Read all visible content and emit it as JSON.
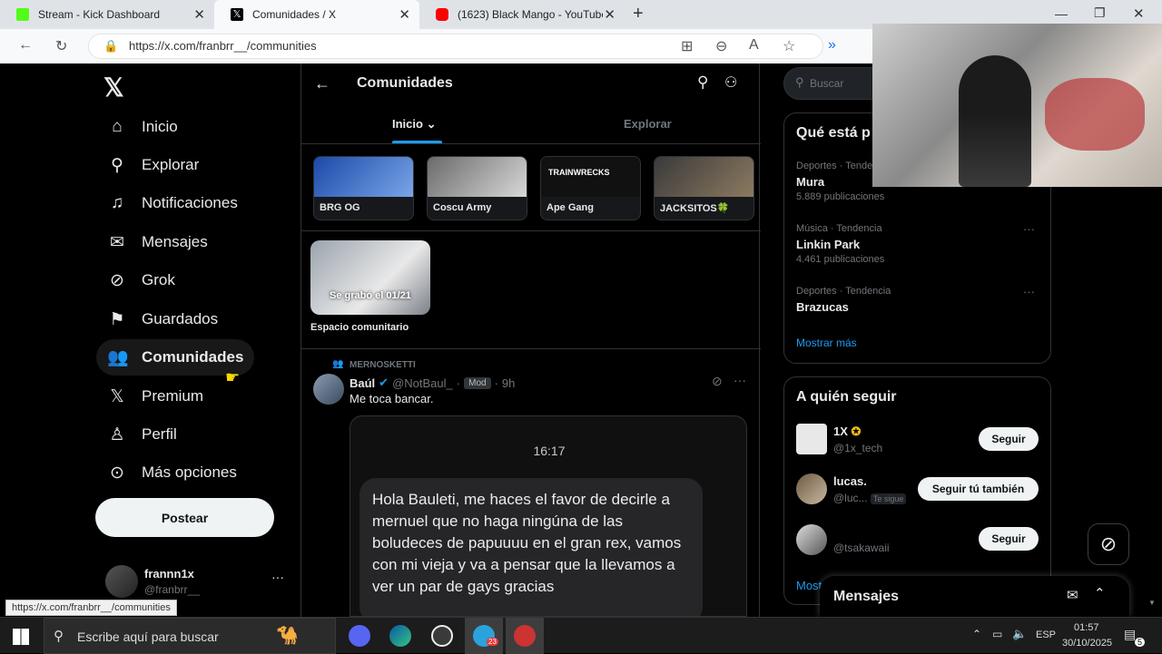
{
  "browser": {
    "tabs": [
      {
        "title": "Stream - Kick Dashboard",
        "favicon_color": "#53fc18"
      },
      {
        "title": "Comunidades / X",
        "favicon_color": "#000000"
      },
      {
        "title": "(1623) Black Mango - YouTube",
        "favicon_color": "#ff0000"
      }
    ],
    "url": "https://x.com/franbrr__/communities",
    "status_url": "https://x.com/franbrr__/communities"
  },
  "sidebar": {
    "items": [
      {
        "label": "Inicio",
        "icon": "home-icon"
      },
      {
        "label": "Explorar",
        "icon": "search-icon"
      },
      {
        "label": "Notificaciones",
        "icon": "bell-icon"
      },
      {
        "label": "Mensajes",
        "icon": "mail-icon"
      },
      {
        "label": "Grok",
        "icon": "grok-icon"
      },
      {
        "label": "Guardados",
        "icon": "bookmark-icon"
      },
      {
        "label": "Comunidades",
        "icon": "people-icon"
      },
      {
        "label": "Premium",
        "icon": "x-icon"
      },
      {
        "label": "Perfil",
        "icon": "person-icon"
      },
      {
        "label": "Más opciones",
        "icon": "more-circle-icon"
      }
    ],
    "post_label": "Postear",
    "account": {
      "name": "frannn1x",
      "handle": "@franbrr__",
      "more": "···"
    }
  },
  "main": {
    "title": "Comunidades",
    "tabs": [
      {
        "label": "Inicio"
      },
      {
        "label": "Explorar"
      }
    ],
    "communities": [
      "BRG OG",
      "Coscu Army",
      "Ape Gang",
      "JACKSITOS🍀"
    ],
    "space": {
      "overlay": "Se grabó el 01/21",
      "label": "Espacio comunitario"
    },
    "post": {
      "community": "MERNOSKETTI",
      "author": "Baúl",
      "handle": "@NotBaul_",
      "badge": "Mod",
      "time": "9h",
      "dot": "·",
      "text": "Me toca bancar.",
      "image_time": "16:17",
      "image_message": "Hola Bauleti, me haces el favor de decirle a mernuel que no haga ningúna de las boludeces de papuuuu en el gran rex, vamos con mi vieja y va a pensar que la llevamos a ver un par de gays gracias"
    }
  },
  "right": {
    "search_placeholder": "Buscar",
    "trends_title": "Qué está p",
    "trends": [
      {
        "category": "Deportes · Tendencia",
        "name": "Mura",
        "count": "5.889 publicaciones"
      },
      {
        "category": "Música · Tendencia",
        "name": "Linkin Park",
        "count": "4.461 publicaciones"
      },
      {
        "category": "Deportes · Tendencia",
        "name": "Brazucas",
        "count": ""
      }
    ],
    "show_more": "Mostrar más",
    "follow_title": "A quién seguir",
    "follow": [
      {
        "name": "1X",
        "handle": "@1x_tech",
        "button": "Seguir",
        "extra": ""
      },
      {
        "name": "lucas.",
        "handle": "@luc...",
        "button": "Seguir tú también",
        "extra": "Te sigue"
      },
      {
        "name": "",
        "handle": "@tsakawaii",
        "button": "Seguir",
        "extra": ""
      }
    ],
    "more_link": "Most",
    "messages_label": "Mensajes"
  },
  "taskbar": {
    "search_placeholder": "Escribe aquí para buscar",
    "lang": "ESP",
    "time": "01:57",
    "date": "30/10/2025",
    "notif_count": "5",
    "app_badge_telegram": "23"
  }
}
